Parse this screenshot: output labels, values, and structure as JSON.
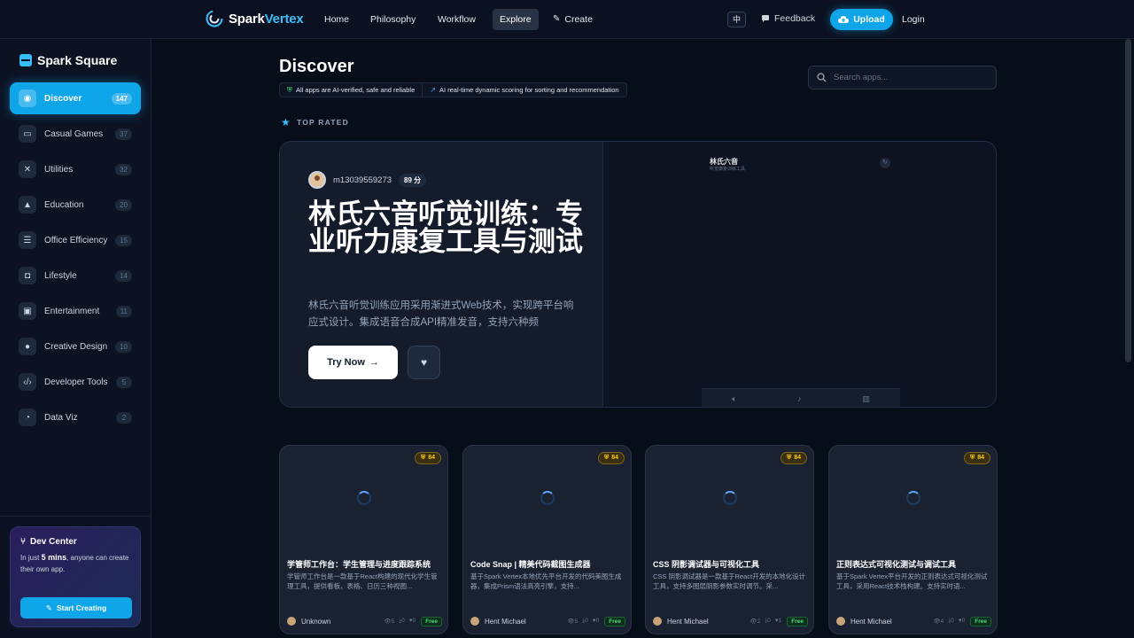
{
  "brand": {
    "name_a": "Spark",
    "name_b": "Vertex"
  },
  "nav": {
    "items": [
      "Home",
      "Philosophy",
      "Workflow",
      "Explore",
      "Create"
    ],
    "active": "Explore",
    "lang": "中",
    "feedback": "Feedback",
    "upload": "Upload",
    "login": "Login"
  },
  "sidebar": {
    "title": "Spark Square",
    "items": [
      {
        "label": "Discover",
        "count": "147",
        "icon": "compass-icon",
        "active": true
      },
      {
        "label": "Casual Games",
        "count": "37",
        "icon": "gamepad-icon"
      },
      {
        "label": "Utilities",
        "count": "32",
        "icon": "tools-icon"
      },
      {
        "label": "Education",
        "count": "20",
        "icon": "graduation-cap-icon"
      },
      {
        "label": "Office Efficiency",
        "count": "15",
        "icon": "list-icon"
      },
      {
        "label": "Lifestyle",
        "count": "14",
        "icon": "coffee-icon"
      },
      {
        "label": "Entertainment",
        "count": "11",
        "icon": "film-icon"
      },
      {
        "label": "Creative Design",
        "count": "10",
        "icon": "palette-icon"
      },
      {
        "label": "Developer Tools",
        "count": "5",
        "icon": "code-icon"
      },
      {
        "label": "Data Viz",
        "count": "2",
        "icon": "pie-chart-icon"
      }
    ],
    "dev_center": {
      "title": "Dev Center",
      "desc_prefix": "In just ",
      "desc_bold": "5 mins",
      "desc_suffix": ", anyone can create their own app.",
      "button": "Start Creating"
    }
  },
  "main": {
    "title": "Discover",
    "tag_1": "All apps are AI-verified, safe and reliable",
    "tag_2": "AI real-time dynamic scoring for sorting and recommendation",
    "search_placeholder": "Search apps...",
    "section_label": "TOP RATED"
  },
  "hero": {
    "author": "m13039559273",
    "score": "89 分",
    "title": "林氏六音听觉训练：专业听力康复工具与测试",
    "desc": "林氏六音听觉训练应用采用渐进式Web技术，实现跨平台响应式设计。集成语音合成API精准发音，支持六种频",
    "try_now": "Try Now",
    "preview_title": "林氏六音",
    "preview_sub": "听觉康复训练工具"
  },
  "cards": [
    {
      "score": "84",
      "title": "学管师工作台：学生管理与进度跟踪系统",
      "desc": "学管师工作台是一款基于React构建的现代化学生管理工具，提供看板、表格、日历三种视图...",
      "author": "Unknown",
      "views": "5",
      "downloads": "0",
      "likes": "0",
      "price": "Free"
    },
    {
      "score": "84",
      "title": "Code Snap | 精美代码截图生成器",
      "desc": "基于Spark Vertex本地优先平台开发的代码美图生成器，集成Prism语法高亮引擎，支持...",
      "author": "Hent Michael",
      "views": "5",
      "downloads": "0",
      "likes": "0",
      "price": "Free"
    },
    {
      "score": "84",
      "title": "CSS 阴影调试器与可视化工具",
      "desc": "CSS 阴影调试器是一款基于React开发的本地化设计工具，支持多图层阴影参数实时调节。采...",
      "author": "Hent Michael",
      "views": "2",
      "downloads": "0",
      "likes": "1",
      "price": "Free"
    },
    {
      "score": "84",
      "title": "正则表达式可视化测试与调试工具",
      "desc": "基于Spark Vertex平台开发的正则表达式可视化测试工具，采用React技术栈构建。支持实时语...",
      "author": "Hent Michael",
      "views": "4",
      "downloads": "0",
      "likes": "0",
      "price": "Free"
    }
  ],
  "colors": {
    "accent": "#0ea5e9",
    "bg": "#080d1a",
    "score_gold": "#facc15",
    "free_green": "#4ade80"
  }
}
